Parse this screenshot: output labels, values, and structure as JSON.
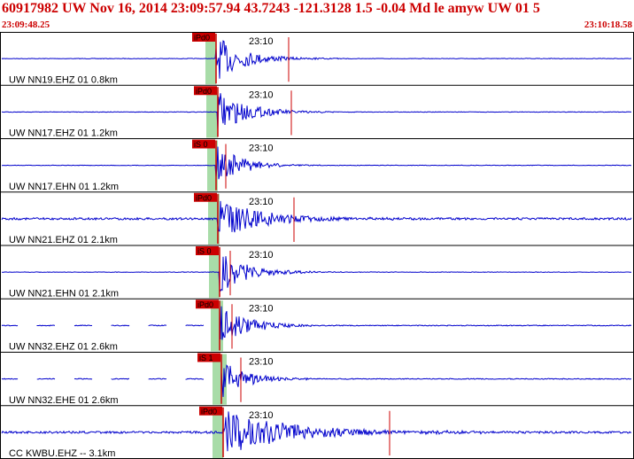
{
  "header": {
    "title": "60917982 UW Nov 16, 2014 23:09:57.94   43.7243 -121.3128  1.5 -0.04 Md le amyw UW 01   5",
    "start_time": "23:09:48.25",
    "end_time": "23:10:18.58"
  },
  "colors": {
    "trace": "#0000cc",
    "pick": "#cc0000",
    "window": "#a8dca8",
    "text": "#000000"
  },
  "traces": [
    {
      "label": "UW NN19.EHZ 01 0.8km",
      "pick": "iPd0",
      "time_mark": "23:10"
    },
    {
      "label": "UW NN17.EHZ 01 1.2km",
      "pick": "iPd0",
      "time_mark": "23:10"
    },
    {
      "label": "UW NN17.EHN 01 1.2km",
      "pick": "iS 0",
      "time_mark": "23:10"
    },
    {
      "label": "UW NN21.EHZ 01 2.1km",
      "pick": "iPd0",
      "time_mark": "23:10"
    },
    {
      "label": "UW NN21.EHN 01 2.1km",
      "pick": "iS 0",
      "time_mark": "23:10"
    },
    {
      "label": "UW NN32.EHZ 01 2.6km",
      "pick": "iPd0",
      "time_mark": "23:10"
    },
    {
      "label": "UW NN32.EHE 01 2.6km",
      "pick": "iS 1",
      "time_mark": "23:10"
    },
    {
      "label": "CC KWBU.EHZ -- 3.1km",
      "pick": "iPd0",
      "time_mark": "23:10"
    }
  ]
}
